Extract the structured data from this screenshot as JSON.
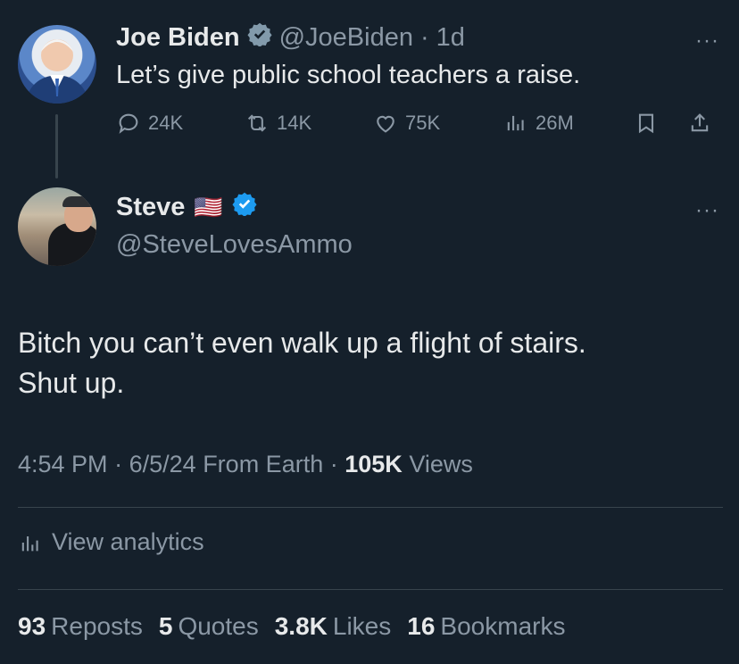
{
  "parent_tweet": {
    "author_name": "Joe Biden",
    "handle": "@JoeBiden",
    "separator": "·",
    "time_ago": "1d",
    "more": "···",
    "text": "Let’s give public school teachers a raise.",
    "actions": {
      "replies": "24K",
      "reposts": "14K",
      "likes": "75K",
      "views": "26M"
    }
  },
  "reply_tweet": {
    "author_name": "Steve",
    "flag": "🇺🇸",
    "handle": "@SteveLovesAmmo",
    "more": "···",
    "text_line1": "Bitch you can’t even walk up a flight of stairs.",
    "text_line2": "Shut up."
  },
  "meta": {
    "time": "4:54 PM",
    "sep1": "·",
    "date": "6/5/24",
    "source": "From Earth",
    "sep2": "·",
    "views_count": "105K",
    "views_label": "Views"
  },
  "analytics": {
    "label": "View analytics"
  },
  "stats": {
    "reposts_count": "93",
    "reposts_label": "Reposts",
    "quotes_count": "5",
    "quotes_label": "Quotes",
    "likes_count": "3.8K",
    "likes_label": "Likes",
    "bookmarks_count": "16",
    "bookmarks_label": "Bookmarks"
  },
  "colors": {
    "background": "#15202b",
    "text": "#e7e9ea",
    "muted": "#8b98a5",
    "verified_blue": "#1d9bf0",
    "verified_gray": "#829aab",
    "divider": "#38444d"
  }
}
